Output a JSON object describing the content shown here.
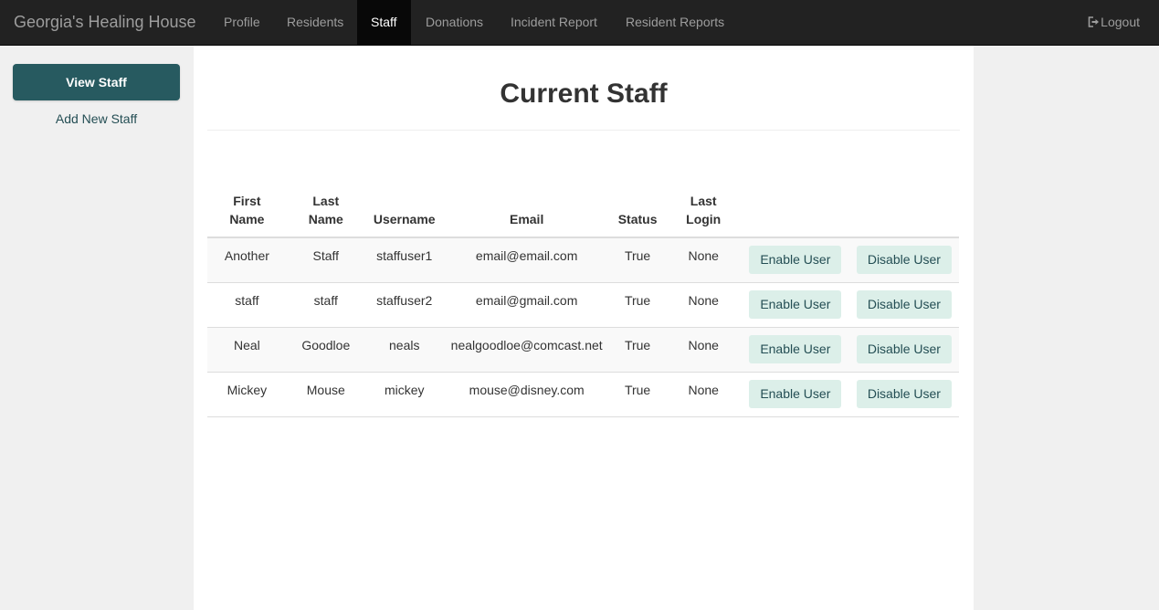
{
  "navbar": {
    "brand": "Georgia's Healing House",
    "items": [
      {
        "label": "Profile"
      },
      {
        "label": "Residents"
      },
      {
        "label": "Staff"
      },
      {
        "label": "Donations"
      },
      {
        "label": "Incident Report"
      },
      {
        "label": "Resident Reports"
      }
    ],
    "active": "Staff",
    "logout_label": "Logout",
    "logout_icon": "sign-out-icon"
  },
  "sidebar": {
    "view_staff_label": "View Staff",
    "add_new_staff_label": "Add New Staff"
  },
  "main": {
    "title": "Current Staff",
    "table": {
      "headers": {
        "first_name_1": "First",
        "first_name_2": "Name",
        "last_name_1": "Last",
        "last_name_2": "Name",
        "username": "Username",
        "email": "Email",
        "status": "Status",
        "last_login": "Last Login"
      },
      "rows": [
        {
          "first": "Another",
          "last": "Staff",
          "username": "staffuser1",
          "email": "email@email.com",
          "status": "True",
          "last_login": "None",
          "enable": "Enable User",
          "disable": "Disable User"
        },
        {
          "first": "staff",
          "last": "staff",
          "username": "staffuser2",
          "email": "email@gmail.com",
          "status": "True",
          "last_login": "None",
          "enable": "Enable User",
          "disable": "Disable User"
        },
        {
          "first": "Neal",
          "last": "Goodloe",
          "username": "neals",
          "email": "nealgoodloe@comcast.net",
          "status": "True",
          "last_login": "None",
          "enable": "Enable User",
          "disable": "Disable User"
        },
        {
          "first": "Mickey",
          "last": "Mouse",
          "username": "mickey",
          "email": "mouse@disney.com",
          "status": "True",
          "last_login": "None",
          "enable": "Enable User",
          "disable": "Disable User"
        }
      ]
    }
  },
  "colors": {
    "navbar_bg": "#222222",
    "nav_text": "#9d9d9d",
    "primary_button": "#275a60",
    "action_button_bg": "#dcefe9",
    "action_button_text": "#244e54"
  }
}
